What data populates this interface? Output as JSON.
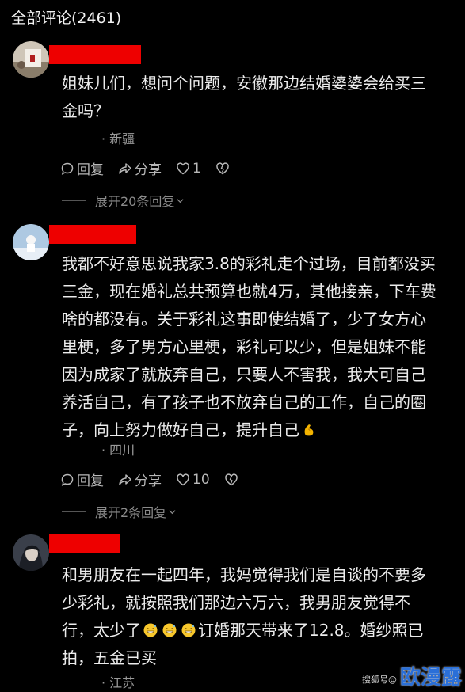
{
  "header": {
    "title": "全部评论(2461)"
  },
  "comments": [
    {
      "lines": [
        "姐妹儿们，想问个问题，安徽那边结婚婆婆会给买三",
        "金吗？"
      ],
      "location": "· 新疆",
      "reply_label": "回复",
      "share_label": "分享",
      "like_count": "1",
      "expand_label": "展开20条回复"
    },
    {
      "lines": [
        "我都不好意思说我家3.8的彩礼走个过场，目前都没买",
        "三金，现在婚礼总共预算也就4万，其他接亲，下车费",
        "啥的都没有。关于彩礼这事即使结婚了，少了女方心",
        "里梗，多了男方心里梗，彩礼可以少，但是姐妹不能",
        "因为成家了就放弃自己，只要人不害我，我大可自己",
        "养活自己，有了孩子也不放弃自己的工作，自己的圈",
        "子，向上努力做好自己，提升自己"
      ],
      "location": "· 四川",
      "reply_label": "回复",
      "share_label": "分享",
      "like_count": "10",
      "expand_label": "展开2条回复"
    },
    {
      "lines": [
        "和男朋友在一起四年，我妈觉得我们是自谈的不要多",
        "少彩礼，就按照我们那边六万六，我男朋友觉得不",
        "订婚那天带来了12.8。婚纱照已",
        "拍，五金已买"
      ],
      "line3_prefix": "行，太少了",
      "location": "· 江苏"
    }
  ],
  "watermark": {
    "small": "搜狐号@",
    "big": "欧漫露"
  },
  "colors": {
    "background": "#000000",
    "redact": "#ee0000",
    "watermark_big": "#2a6fd8"
  }
}
